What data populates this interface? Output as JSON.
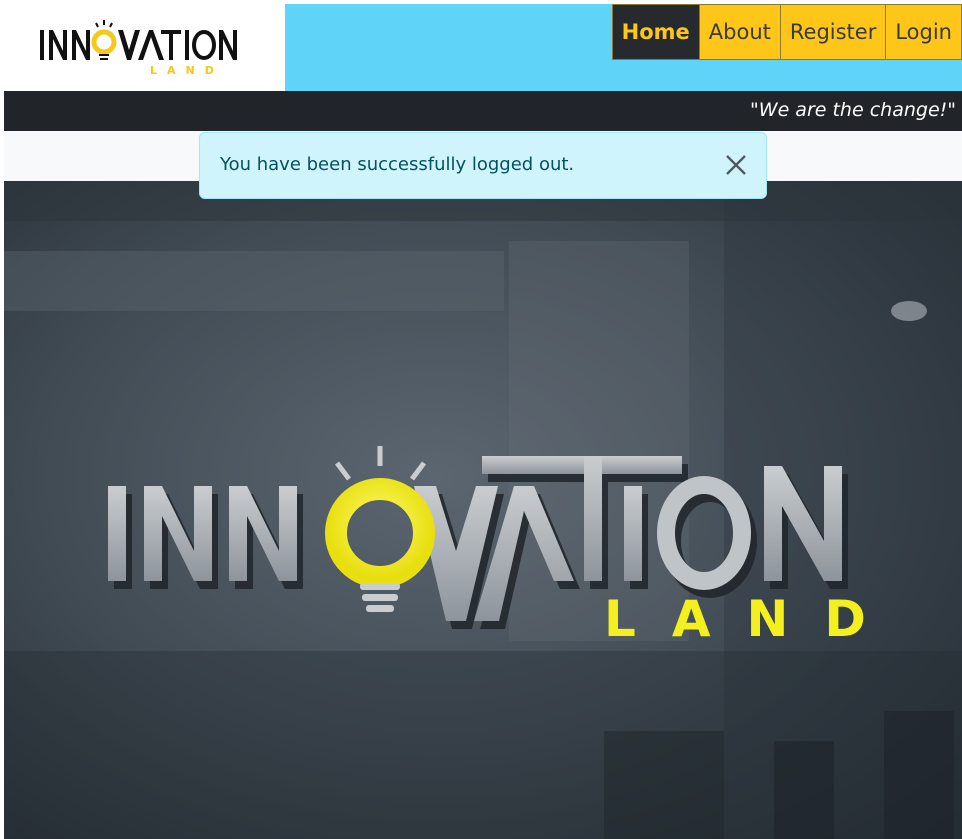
{
  "logo": {
    "brand_main": "INNOVATION",
    "brand_sub": "LAND"
  },
  "nav": {
    "items": [
      {
        "label": "Home",
        "active": true
      },
      {
        "label": "About",
        "active": false
      },
      {
        "label": "Register",
        "active": false
      },
      {
        "label": "Login",
        "active": false
      }
    ]
  },
  "tagline": "\"We are the change!\"",
  "alert": {
    "message": "You have been successfully logged out.",
    "close_icon": "close-icon"
  },
  "hero": {
    "brand_main": "INNOVATION",
    "brand_sub": "LAND"
  },
  "colors": {
    "header_bg": "#5fd4f8",
    "nav_bg": "#ffc61a",
    "nav_active_bg": "#262a2e",
    "nav_active_text": "#ffc61a",
    "tagline_bar": "#212529",
    "alert_bg": "#cff4fc",
    "alert_text": "#055160",
    "bulb_yellow": "#f4ef1e"
  }
}
